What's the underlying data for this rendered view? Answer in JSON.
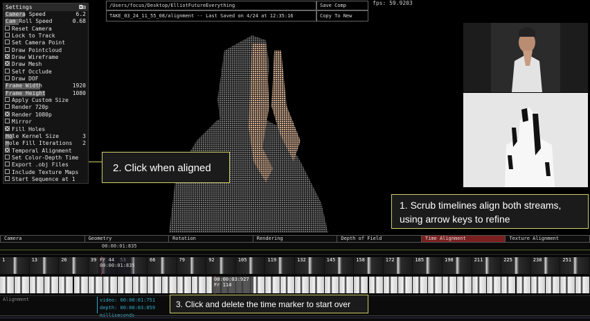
{
  "settings": {
    "title": "Settings",
    "pin_glyph": "◘⊠",
    "rows": [
      {
        "kind": "slider",
        "label": "Camera Speed",
        "value": "6.2",
        "fill": 0.25
      },
      {
        "kind": "slider",
        "label": "Cam Roll Speed",
        "value": "0.68",
        "fill": 0.17
      },
      {
        "kind": "toggle",
        "label": "Reset Camera",
        "checked": false
      },
      {
        "kind": "toggle",
        "label": "Lock to Track",
        "checked": false
      },
      {
        "kind": "toggle",
        "label": "Set Camera Point",
        "checked": false
      },
      {
        "kind": "toggle",
        "label": "Draw Pointcloud",
        "checked": false
      },
      {
        "kind": "toggle",
        "label": "Draw Wireframe",
        "checked": true
      },
      {
        "kind": "toggle",
        "label": "Draw Mesh",
        "checked": true
      },
      {
        "kind": "toggle",
        "label": "Self Occlude",
        "checked": false
      },
      {
        "kind": "toggle",
        "label": "Draw DOF",
        "checked": false
      },
      {
        "kind": "slider",
        "label": "Frame Width",
        "value": "1920",
        "fill": 0.44
      },
      {
        "kind": "slider",
        "label": "Frame Height",
        "value": "1080",
        "fill": 0.5
      },
      {
        "kind": "toggle",
        "label": "Apply Custom Size",
        "checked": false
      },
      {
        "kind": "toggle",
        "label": "Render 720p",
        "checked": false
      },
      {
        "kind": "toggle",
        "label": "Render 1080p",
        "checked": true
      },
      {
        "kind": "toggle",
        "label": "Mirror",
        "checked": false
      },
      {
        "kind": "toggle",
        "label": "Fill Holes",
        "checked": true
      },
      {
        "kind": "slider",
        "label": "Hole Kernel Size",
        "value": "3",
        "fill": 0.1
      },
      {
        "kind": "slider",
        "label": "Hole Fill Iterations",
        "value": "2",
        "fill": 0.05
      },
      {
        "kind": "toggle",
        "label": "Temporal Alignment",
        "checked": true
      },
      {
        "kind": "toggle",
        "label": "Set Color-Depth Time",
        "checked": false
      },
      {
        "kind": "toggle",
        "label": "Export .obj Files",
        "checked": false
      },
      {
        "kind": "toggle",
        "label": "Include Texture Maps",
        "checked": false
      },
      {
        "kind": "toggle",
        "label": "Start Sequence at 1",
        "checked": false
      }
    ]
  },
  "topbar": {
    "path": "/Users/focus/Desktop/ElliotFutureEverything",
    "status": "TAKE_03_24_11_55_08/alignment -- Last Saved on 4/24 at 12:35:16",
    "save_comp": "Save Comp",
    "copy_to_new": "Copy To New",
    "fps": "fps: 59.9203"
  },
  "callouts": {
    "one": "2. Click when aligned",
    "two_line1": "1. Scrub timelines align both streams,",
    "two_line2": "using arrow keys to refine",
    "three": "3. Click and delete the time marker to start over"
  },
  "tabs": [
    {
      "label": "Camera",
      "active": false
    },
    {
      "label": "Geometry",
      "active": false
    },
    {
      "label": "Rotation",
      "active": false
    },
    {
      "label": "Rendering",
      "active": false
    },
    {
      "label": "Depth of Field",
      "active": false
    },
    {
      "label": "Time Alignment",
      "active": true
    },
    {
      "label": "Texture Alignment",
      "active": false
    }
  ],
  "ruler": {
    "time": "00:00:01:835"
  },
  "rgb_track": {
    "labels": [
      "1",
      "13",
      "26",
      "39",
      "53",
      "66",
      "79",
      "92",
      "105",
      "119",
      "132",
      "145",
      "158",
      "172",
      "185",
      "198",
      "211",
      "225",
      "238",
      "251"
    ],
    "marker_frame": "Fr 44",
    "marker_time": "00:00:01:835"
  },
  "depth_track": {
    "marker_time": "00:00:03:927",
    "marker_frame": "Fr 114"
  },
  "alignment": {
    "label": "Alignment",
    "video": "video: 00:00:01:751",
    "depth": "depth: 00:00:03:859 milliseconds"
  },
  "colors": {
    "accent_callout_border": "#cfcf6a",
    "active_tab": "#7a1f1f",
    "alignment_readout": "#33aacc"
  }
}
